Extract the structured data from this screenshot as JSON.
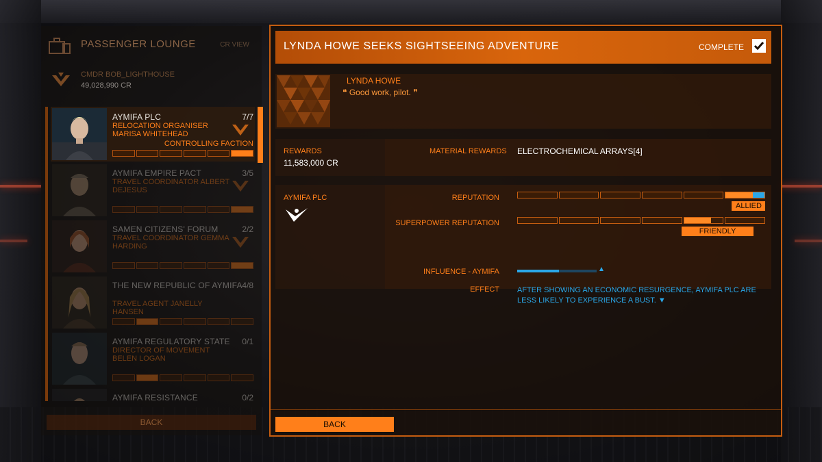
{
  "lounge": {
    "title": "PASSENGER LOUNGE",
    "credit_tag": "CR VIEW"
  },
  "commander": {
    "name": "CMDR BOB_LIGHTHOUSE",
    "credits": "49,028,990 CR"
  },
  "missions_list": [
    {
      "faction": "AYMIFA PLC",
      "count": "7/7",
      "role": "RELOCATION ORGANISER MARISA WHITEHEAD",
      "status": "CONTROLLING FACTION"
    },
    {
      "faction": "AYMIFA EMPIRE PACT",
      "count": "3/5",
      "role": "TRAVEL COORDINATOR ALBERT DEJESUS",
      "status": ""
    },
    {
      "faction": "SAMEN CITIZENS' FORUM",
      "count": "2/2",
      "role": "TRAVEL COORDINATOR GEMMA HARDING",
      "status": ""
    },
    {
      "faction": "THE NEW REPUBLIC OF AYMIFA",
      "count": "4/8",
      "role": "TRAVEL AGENT JANELLY HANSEN",
      "status": ""
    },
    {
      "faction": "AYMIFA REGULATORY STATE",
      "count": "0/1",
      "role": "DIRECTOR OF MOVEMENT BELEN LOGAN",
      "status": ""
    },
    {
      "faction": "AYMIFA RESISTANCE",
      "count": "0/2",
      "role": "",
      "status": ""
    }
  ],
  "left_back_label": "BACK",
  "mission": {
    "title": "LYNDA HOWE SEEKS SIGHTSEEING ADVENTURE",
    "complete_label": "COMPLETE",
    "giver_name": "LYNDA HOWE",
    "quote_open": "❝",
    "quote_text": "Good work, pilot.",
    "quote_close": "❞"
  },
  "rewards": {
    "label": "REWARDS",
    "value": "11,583,000 CR",
    "material_label": "MATERIAL REWARDS",
    "material_value": "ELECTROCHEMICAL ARRAYS[4]"
  },
  "faction": {
    "name": "AYMIFA PLC",
    "reputation_label": "REPUTATION",
    "reputation_level": 1.0,
    "reputation_status": "ALLIED",
    "superpower_label": "SUPERPOWER REPUTATION",
    "superpower_level": 0.72,
    "superpower_status": "FRIENDLY",
    "influence_label": "INFLUENCE - AYMIFA",
    "influence_level": 0.53,
    "effect_label": "EFFECT",
    "effect_text": "AFTER SHOWING AN ECONOMIC RESURGENCE, AYMIFA PLC ARE LESS LIKELY TO EXPERIENCE A BUST.",
    "effect_arrow": "▼"
  },
  "right_back_label": "BACK",
  "colors": {
    "accent": "#ff7f1a",
    "influence": "#2aa7e8",
    "header": "#d9650c"
  }
}
